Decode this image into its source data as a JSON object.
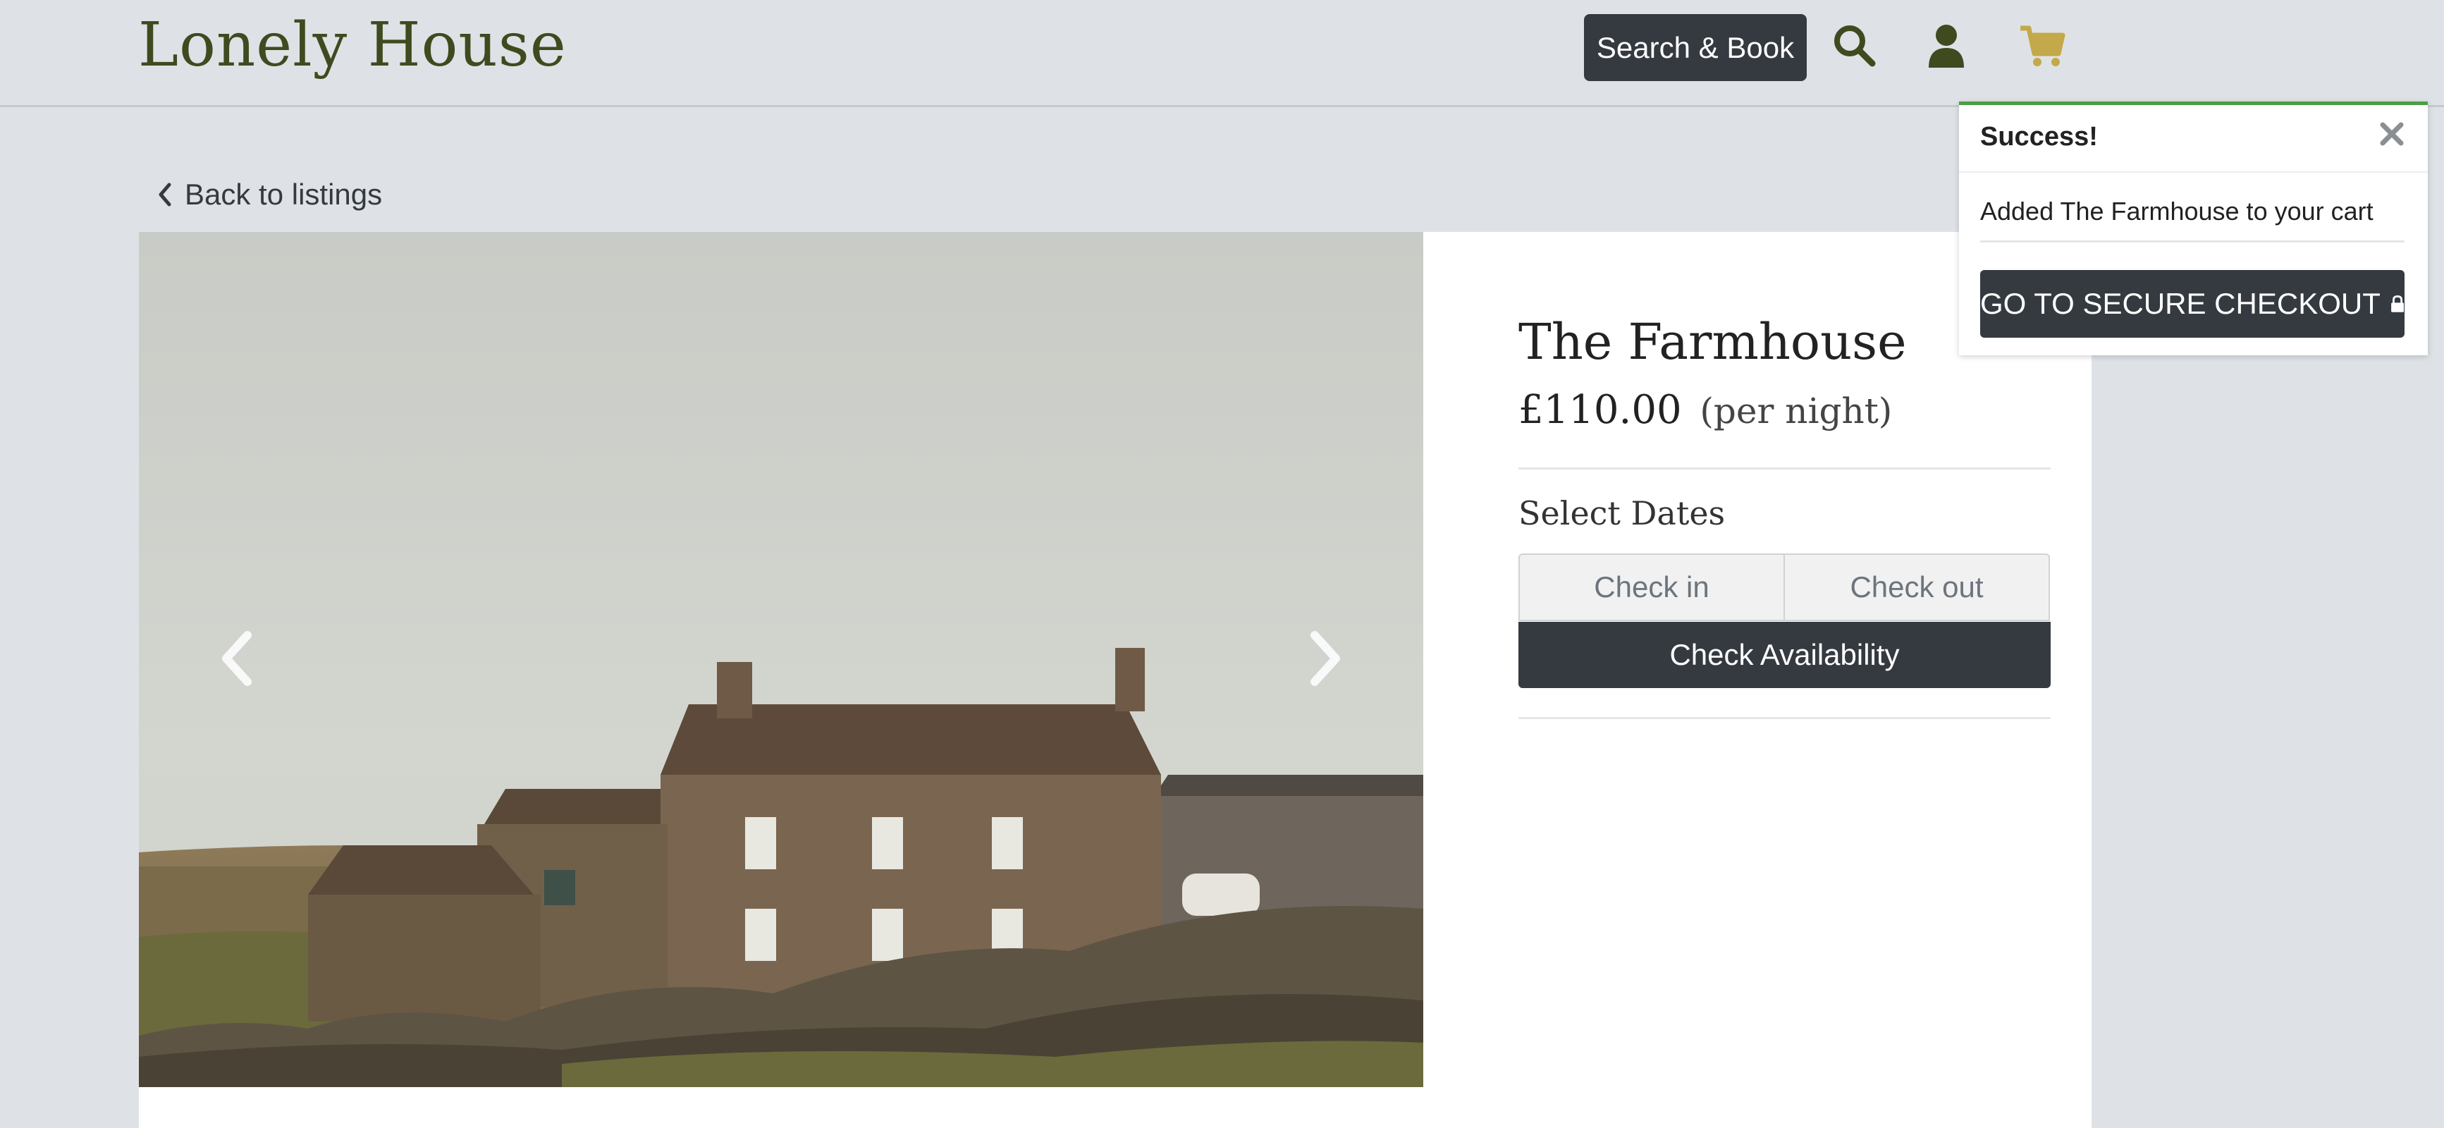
{
  "header": {
    "logo": "Lonely House",
    "search_book_label": "Search & Book",
    "icons": [
      "search-icon",
      "user-icon",
      "cart-icon"
    ],
    "cart_color": "#c4a94a",
    "icon_color": "#3f4a1f"
  },
  "nav": {
    "back_label": "Back to listings"
  },
  "listing": {
    "title": "The Farmhouse",
    "price": "£110.00",
    "price_unit": "(per night)",
    "select_dates_label": "Select Dates",
    "check_in_placeholder": "Check in",
    "check_out_placeholder": "Check out",
    "check_availability_label": "Check Availability"
  },
  "toast": {
    "title": "Success!",
    "message": "Added The Farmhouse to your cart",
    "checkout_label": "GO TO SECURE CHECKOUT",
    "accent": "#4b9e46"
  }
}
